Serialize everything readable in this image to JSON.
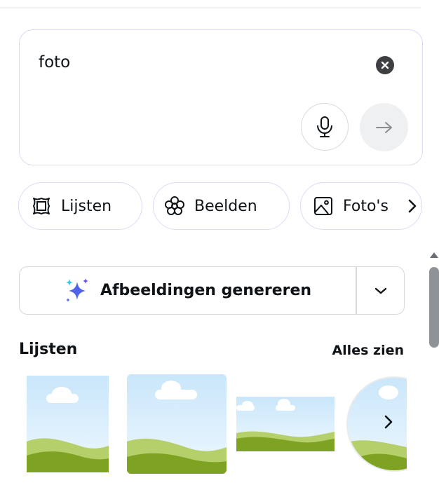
{
  "search": {
    "query": "foto"
  },
  "icons": {
    "clear": "close-icon",
    "mic": "microphone-icon",
    "submit": "arrow-right-icon",
    "frames": "frame-icon",
    "graphics": "flower-icon",
    "photos": "image-icon",
    "sparkle": "sparkle-icon",
    "dropdown": "chevron-down-icon",
    "next": "chevron-right-icon"
  },
  "chips": [
    {
      "label": "Lijsten"
    },
    {
      "label": "Beelden"
    },
    {
      "label": "Foto's"
    }
  ],
  "generate": {
    "label": "Afbeeldingen genereren"
  },
  "section": {
    "title": "Lijsten",
    "see_all": "Alles zien"
  },
  "colors": {
    "sky_top": "#c9e6fa",
    "sky_bottom": "#eaf6ff",
    "hill_light": "#b5cf6a",
    "hill_dark": "#7ea323",
    "chip_border": "#dcdcf6",
    "sparkle_blue": "#4f63e8",
    "sparkle_cyan": "#35c5e8"
  }
}
